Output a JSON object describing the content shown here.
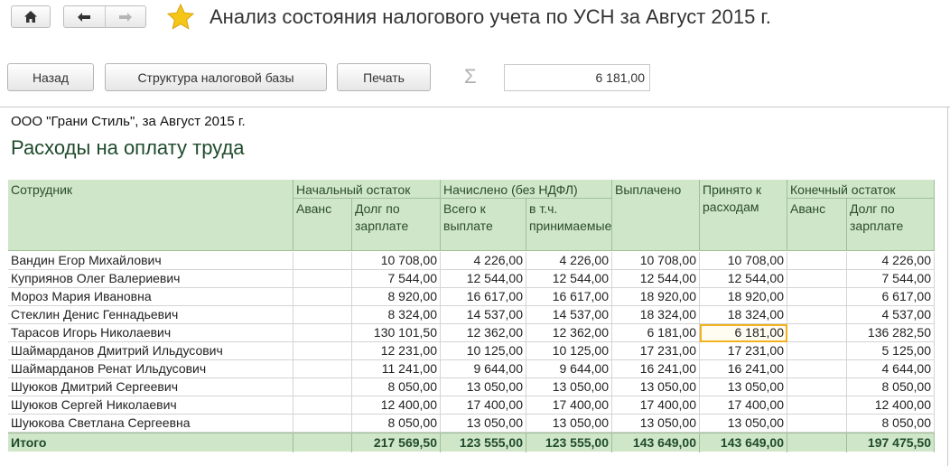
{
  "window": {
    "title": "Анализ состояния налогового учета по УСН за Август 2015 г."
  },
  "toolbar": {
    "back_label": "Назад",
    "structure_label": "Структура налоговой базы",
    "print_label": "Печать",
    "sum_symbol": "Σ",
    "sum_value": "6 181,00"
  },
  "report": {
    "org_line": "ООО \"Грани Стиль\",  за Август 2015 г.",
    "title": "Расходы на оплату труда",
    "headers": {
      "employee": "Сотрудник",
      "opening_balance": "Начальный остаток",
      "advance": "Аванс",
      "salary_debt": "Долг по зарплате",
      "accrued": "Начислено (без НДФЛ)",
      "total_to_pay": "Всего к выплате",
      "incl_accepted": "в т.ч. принимаемые",
      "paid": "Выплачено",
      "accepted_expenses": "Принято к расходам",
      "closing_balance": "Конечный остаток",
      "advance_end": "Аванс",
      "salary_debt_end": "Долг по зарплате"
    },
    "rows": [
      {
        "name": "Вандин Егор Михайлович",
        "adv": "",
        "debt": "10 708,00",
        "total": "4 226,00",
        "acc": "4 226,00",
        "paid": "10 708,00",
        "exp": "10 708,00",
        "adv2": "",
        "debt2": "4 226,00"
      },
      {
        "name": "Куприянов Олег Валериевич",
        "adv": "",
        "debt": "7 544,00",
        "total": "12 544,00",
        "acc": "12 544,00",
        "paid": "12 544,00",
        "exp": "12 544,00",
        "adv2": "",
        "debt2": "7 544,00"
      },
      {
        "name": "Мороз Мария Ивановна",
        "adv": "",
        "debt": "8 920,00",
        "total": "16 617,00",
        "acc": "16 617,00",
        "paid": "18 920,00",
        "exp": "18 920,00",
        "adv2": "",
        "debt2": "6 617,00"
      },
      {
        "name": "Стеклин Денис Геннадьевич",
        "adv": "",
        "debt": "8 324,00",
        "total": "14 537,00",
        "acc": "14 537,00",
        "paid": "18 324,00",
        "exp": "18 324,00",
        "adv2": "",
        "debt2": "4 537,00"
      },
      {
        "name": "Тарасов Игорь Николаевич",
        "adv": "",
        "debt": "130 101,50",
        "total": "12 362,00",
        "acc": "12 362,00",
        "paid": "6 181,00",
        "exp": "6 181,00",
        "adv2": "",
        "debt2": "136 282,50"
      },
      {
        "name": "Шаймарданов Дмитрий Ильдусович",
        "adv": "",
        "debt": "12 231,00",
        "total": "10 125,00",
        "acc": "10 125,00",
        "paid": "17 231,00",
        "exp": "17 231,00",
        "adv2": "",
        "debt2": "5 125,00"
      },
      {
        "name": "Шаймарданов Ренат Ильдусович",
        "adv": "",
        "debt": "11 241,00",
        "total": "9 644,00",
        "acc": "9 644,00",
        "paid": "16 241,00",
        "exp": "16 241,00",
        "adv2": "",
        "debt2": "4 644,00"
      },
      {
        "name": "Шуюков Дмитрий Сергеевич",
        "adv": "",
        "debt": "8 050,00",
        "total": "13 050,00",
        "acc": "13 050,00",
        "paid": "13 050,00",
        "exp": "13 050,00",
        "adv2": "",
        "debt2": "8 050,00"
      },
      {
        "name": "Шуюков Сергей Николаевич",
        "adv": "",
        "debt": "12 400,00",
        "total": "17 400,00",
        "acc": "17 400,00",
        "paid": "17 400,00",
        "exp": "17 400,00",
        "adv2": "",
        "debt2": "12 400,00"
      },
      {
        "name": "Шуюкова Светлана Сергеевна",
        "adv": "",
        "debt": "8 050,00",
        "total": "13 050,00",
        "acc": "13 050,00",
        "paid": "13 050,00",
        "exp": "13 050,00",
        "adv2": "",
        "debt2": "8 050,00"
      }
    ],
    "totals": {
      "label": "Итого",
      "adv": "",
      "debt": "217 569,50",
      "total": "123 555,00",
      "acc": "123 555,00",
      "paid": "143 649,00",
      "exp": "143 649,00",
      "adv2": "",
      "debt2": "197 475,50"
    }
  },
  "colors": {
    "header_bg": "#cfe6c8",
    "title_green": "#1f4b2c",
    "highlight": "#f2b21f"
  },
  "icons": {
    "home": "home-icon",
    "back": "arrow-left-icon",
    "forward": "arrow-right-icon",
    "favorite": "star-icon"
  }
}
